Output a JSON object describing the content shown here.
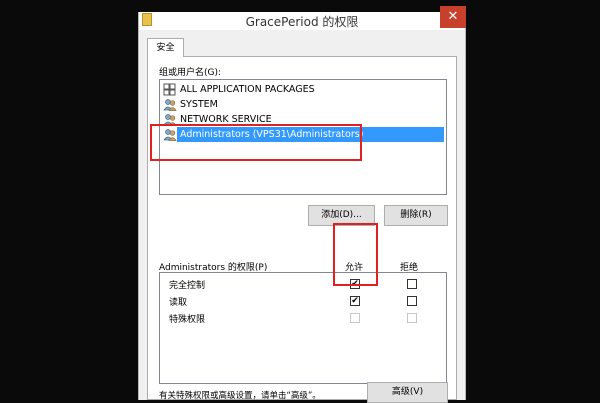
{
  "window": {
    "title": "GracePeriod 的权限",
    "close_glyph": "✕"
  },
  "tab": {
    "label": "安全"
  },
  "groups": {
    "label": "组或用户名(G):",
    "items": [
      {
        "name": "ALL APPLICATION PACKAGES",
        "icon": "package-group-icon",
        "selected": false
      },
      {
        "name": "SYSTEM",
        "icon": "users-icon",
        "selected": false
      },
      {
        "name": "NETWORK SERVICE",
        "icon": "users-icon",
        "selected": false
      },
      {
        "name": "Administrators (VPS31\\Administrators)",
        "icon": "users-icon",
        "selected": true
      }
    ]
  },
  "buttons": {
    "add": "添加(D)...",
    "remove": "删除(R)",
    "advanced": "高级(V)"
  },
  "permissions": {
    "label": "Administrators 的权限(P)",
    "allow_header": "允许",
    "deny_header": "拒绝",
    "rows": [
      {
        "name": "完全控制",
        "allow": true,
        "deny": false,
        "enabled": true
      },
      {
        "name": "读取",
        "allow": true,
        "deny": false,
        "enabled": true
      },
      {
        "name": "特殊权限",
        "allow": false,
        "deny": false,
        "enabled": false
      }
    ]
  },
  "footer": {
    "text": "有关特殊权限或高级设置，请单击“高级”。"
  },
  "colors": {
    "selection": "#3399ff",
    "highlight": "#e0211f",
    "close": "#c7402c"
  }
}
